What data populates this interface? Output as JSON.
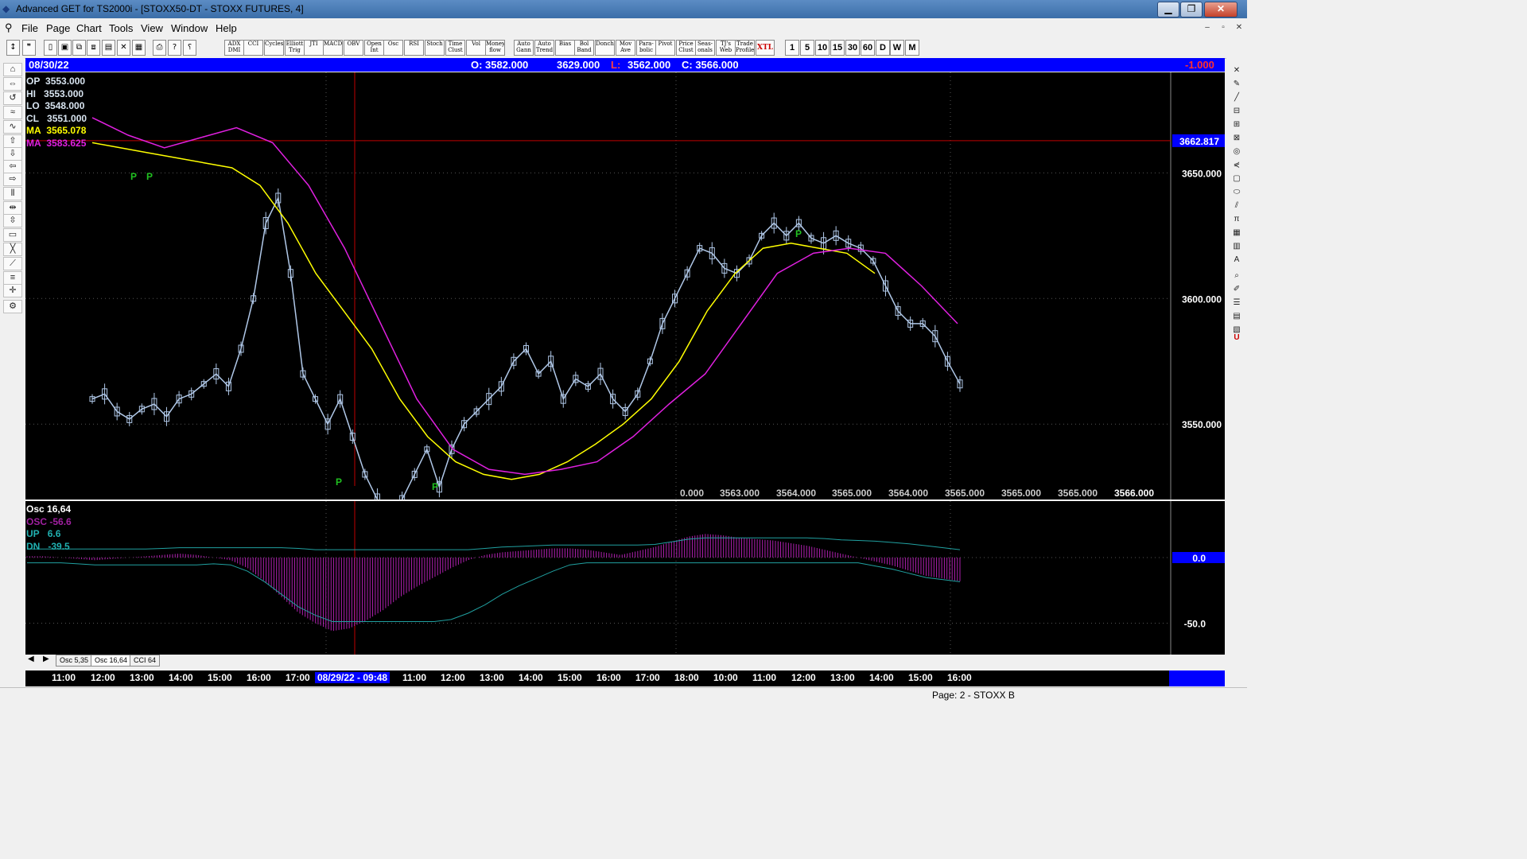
{
  "window": {
    "title": "Advanced GET for TS2000i - [STOXX50-DT - STOXX FUTURES, 4]",
    "controls": {
      "minimize": "▁",
      "maximize": "❐",
      "close": "✕"
    }
  },
  "menubar": {
    "items": [
      "File",
      "Page",
      "Chart",
      "Tools",
      "View",
      "Window",
      "Help"
    ],
    "mdi": {
      "minimize": "–",
      "restore": "▫",
      "close": "✕"
    }
  },
  "toolbar": {
    "left_icons": [
      "pointer-icon",
      "quote-icon",
      "new-icon",
      "open-icon",
      "print-preview-icon",
      "copy-icon",
      "chart-icon",
      "delete-icon",
      "grid-icon",
      "printer-icon",
      "help-icon",
      "context-help-icon"
    ],
    "studies": [
      "ADX DMI",
      "CCI",
      "Cycles",
      "Elliott Trig",
      "JTI",
      "MACD",
      "OBV",
      "Open Int",
      "Osc",
      "RSI",
      "Stoch",
      "Time Clust",
      "Vol",
      "Money flow",
      "Auto Gann",
      "Auto Trend",
      "Bias",
      "Bol Band",
      "Donch",
      "Mov Ave",
      "Para- bolic",
      "Pivot",
      "Price Clust",
      "Seas- onals",
      "TJ's Web",
      "Trade Profile",
      "XTL"
    ],
    "timeframes": [
      "1",
      "5",
      "10",
      "15",
      "30",
      "60",
      "D",
      "W",
      "M"
    ]
  },
  "infobar": {
    "date": "08/30/22",
    "open": "O: 3582.000",
    "high": "3629.000",
    "low_label": "L:",
    "low": "3562.000",
    "close": "C: 3566.000",
    "change": "-1.000"
  },
  "legend": {
    "op": {
      "label": "OP",
      "value": "3553.000"
    },
    "hi": {
      "label": "HI",
      "value": "3553.000"
    },
    "lo": {
      "label": "LO",
      "value": "3548.000"
    },
    "cl": {
      "label": "CL",
      "value": "3551.000"
    },
    "ma1": {
      "label": "MA",
      "value": "3565.078"
    },
    "ma2": {
      "label": "MA",
      "value": "3583.625"
    }
  },
  "price_axis": {
    "ticks": [
      "3650.000",
      "3600.000",
      "3550.000"
    ],
    "crosshair_value": "3662.817"
  },
  "pivot_marks": [
    "P",
    "P",
    "P",
    "P",
    "P"
  ],
  "projection_values": [
    "0.000",
    "3563.000",
    "3564.000",
    "3565.000",
    "3564.000",
    "3565.000",
    "3565.000",
    "3565.000",
    "3566.000"
  ],
  "oscillator": {
    "title": "Osc 16,64",
    "osc": {
      "label": "OSC",
      "value": "-56.6"
    },
    "up": {
      "label": "UP",
      "value": "6.6"
    },
    "dn": {
      "label": "DN",
      "value": "-39.5"
    },
    "ticks": [
      "0.0",
      "-50.0"
    ]
  },
  "tabs": {
    "items": [
      "Osc 5,35",
      "Osc 16,64",
      "CCI 64"
    ],
    "active_index": 1
  },
  "time_axis": {
    "labels": [
      "11:00",
      "12:00",
      "13:00",
      "14:00",
      "15:00",
      "16:00",
      "17:00",
      "08/29/22 - 09:48",
      "11:00",
      "12:00",
      "13:00",
      "14:00",
      "15:00",
      "16:00",
      "17:00",
      "18:00",
      "10:00",
      "11:00",
      "12:00",
      "13:00",
      "14:00",
      "15:00",
      "16:00"
    ]
  },
  "status": {
    "page": "Page: 2 - STOXX B"
  },
  "colors": {
    "background": "#000000",
    "candles": "#b0c8e8",
    "ma_fast": "#ffff00",
    "ma_slow": "#e020e0",
    "osc_bars": "#b020b0",
    "osc_lines": "#20a0a0",
    "pivot": "#20c020",
    "crosshair": "#c00000",
    "infobar": "#0000ff"
  },
  "chart_data": {
    "type": "candlestick",
    "title": "",
    "ylim": [
      3520,
      3690
    ],
    "price_series": [
      3560,
      3562,
      3555,
      3552,
      3556,
      3558,
      3553,
      3560,
      3562,
      3566,
      3570,
      3565,
      3580,
      3600,
      3630,
      3640,
      3610,
      3570,
      3560,
      3550,
      3560,
      3545,
      3530,
      3520,
      3515,
      3520,
      3530,
      3540,
      3525,
      3540,
      3550,
      3555,
      3560,
      3565,
      3575,
      3580,
      3570,
      3575,
      3560,
      3568,
      3565,
      3570,
      3560,
      3555,
      3562,
      3575,
      3590,
      3600,
      3610,
      3620,
      3618,
      3612,
      3610,
      3615,
      3625,
      3630,
      3625,
      3630,
      3624,
      3622,
      3625,
      3622,
      3620,
      3615,
      3605,
      3595,
      3590,
      3590,
      3585,
      3575,
      3566
    ],
    "ma_fast_series": [
      3662,
      3660,
      3658,
      3656,
      3654,
      3652,
      3645,
      3630,
      3610,
      3595,
      3580,
      3560,
      3545,
      3535,
      3530,
      3528,
      3530,
      3535,
      3542,
      3550,
      3560,
      3575,
      3595,
      3610,
      3620,
      3622,
      3620,
      3618,
      3610
    ],
    "ma_slow_series": [
      3672,
      3665,
      3660,
      3664,
      3668,
      3662,
      3645,
      3620,
      3590,
      3560,
      3540,
      3532,
      3530,
      3532,
      3535,
      3545,
      3558,
      3570,
      3590,
      3610,
      3618,
      3620,
      3618,
      3605,
      3590
    ],
    "osc_series": [
      1,
      1,
      0,
      -1,
      -2,
      -1,
      0,
      1,
      2,
      3,
      2,
      0,
      -2,
      -8,
      -18,
      -30,
      -42,
      -50,
      -56,
      -54,
      -48,
      -40,
      -30,
      -22,
      -15,
      -8,
      -2,
      2,
      4,
      5,
      6,
      7,
      7,
      6,
      4,
      2,
      5,
      8,
      12,
      16,
      18,
      17,
      15,
      14,
      13,
      11,
      9,
      6,
      3,
      0,
      -3,
      -6,
      -10,
      -14,
      -16,
      -18
    ]
  }
}
